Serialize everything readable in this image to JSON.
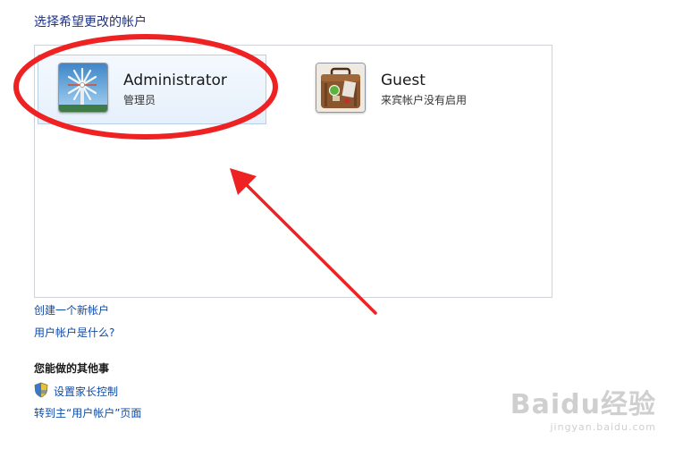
{
  "page": {
    "title": "选择希望更改的帐户"
  },
  "accounts": [
    {
      "name": "Administrator",
      "role": "管理员",
      "picture_icon": "windmill-icon",
      "selected": true
    },
    {
      "name": "Guest",
      "role": "来宾帐户没有启用",
      "picture_icon": "suitcase-icon",
      "selected": false
    }
  ],
  "links": {
    "create_account": "创建一个新帐户",
    "what_is_account": "用户帐户是什么?"
  },
  "other_tasks": {
    "heading": "您能做的其他事",
    "parental_controls": "设置家长控制",
    "go_to_accounts": "转到主“用户帐户”页面"
  },
  "watermark": {
    "main": "Baidu经验",
    "sub": "jingyan.baidu.com"
  },
  "colors": {
    "link": "#0f4aa8",
    "title": "#1e3287",
    "annotation": "#ee2222"
  }
}
